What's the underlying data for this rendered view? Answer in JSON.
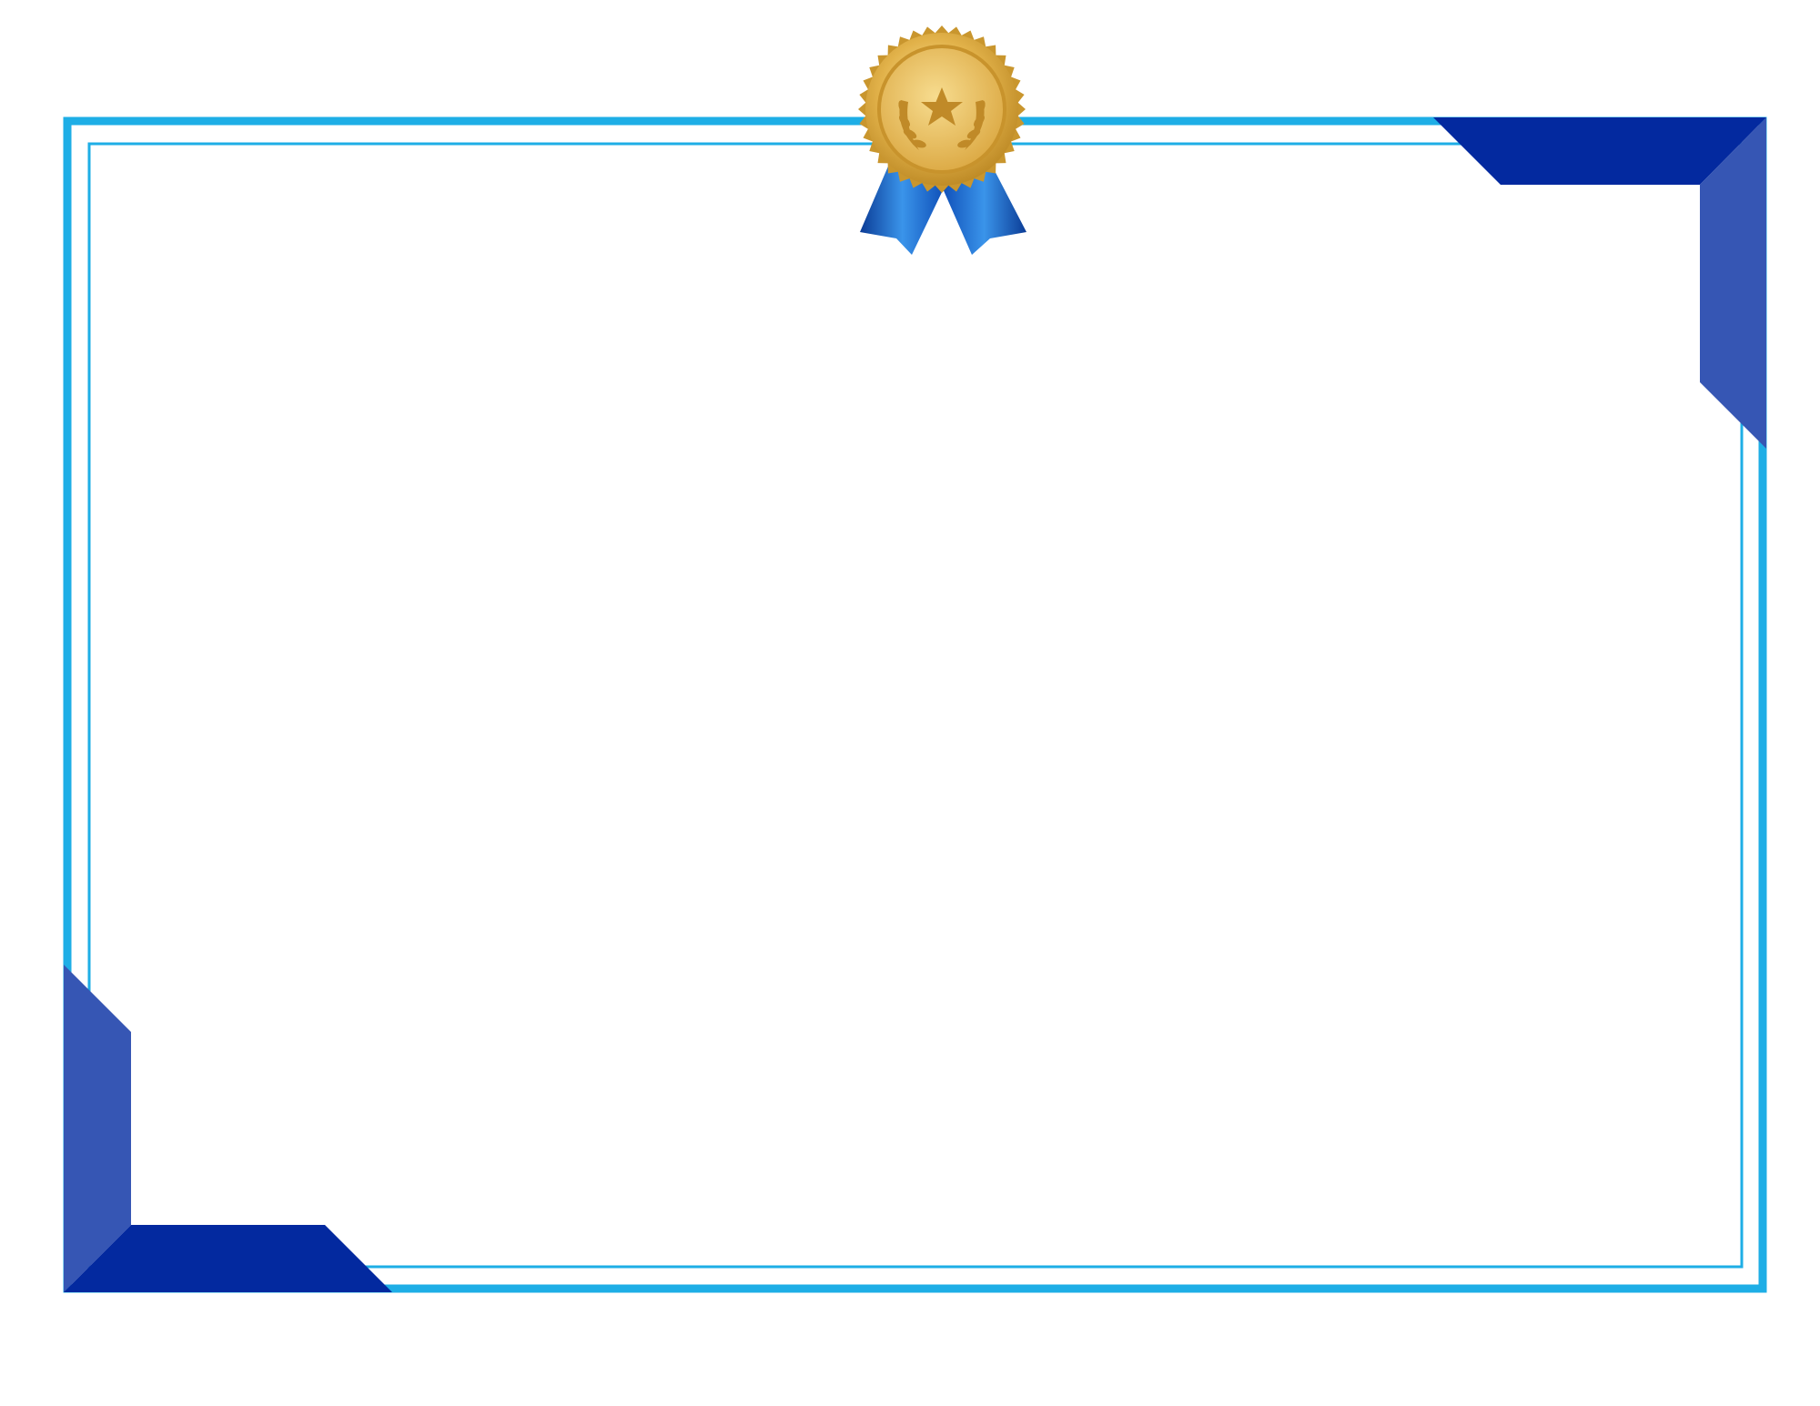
{
  "certificate": {
    "colors": {
      "background": "#ffffff",
      "outer_border": "#1eaee6",
      "inner_border": "#1eaee6",
      "corner_dark": "#03299f",
      "corner_light": "#3656b4",
      "medal_gold": "#e0b24a",
      "medal_gold_dark": "#b88420",
      "medal_gold_light": "#f6dc8a",
      "ribbon_blue": "#1464d2",
      "ribbon_blue_light": "#3a94ea",
      "ribbon_blue_dark": "#0b3c96"
    },
    "icons": {
      "medal": "gold-medal-icon",
      "star": "star-icon",
      "laurel": "laurel-wreath-icon",
      "ribbon": "ribbon-icon"
    }
  }
}
